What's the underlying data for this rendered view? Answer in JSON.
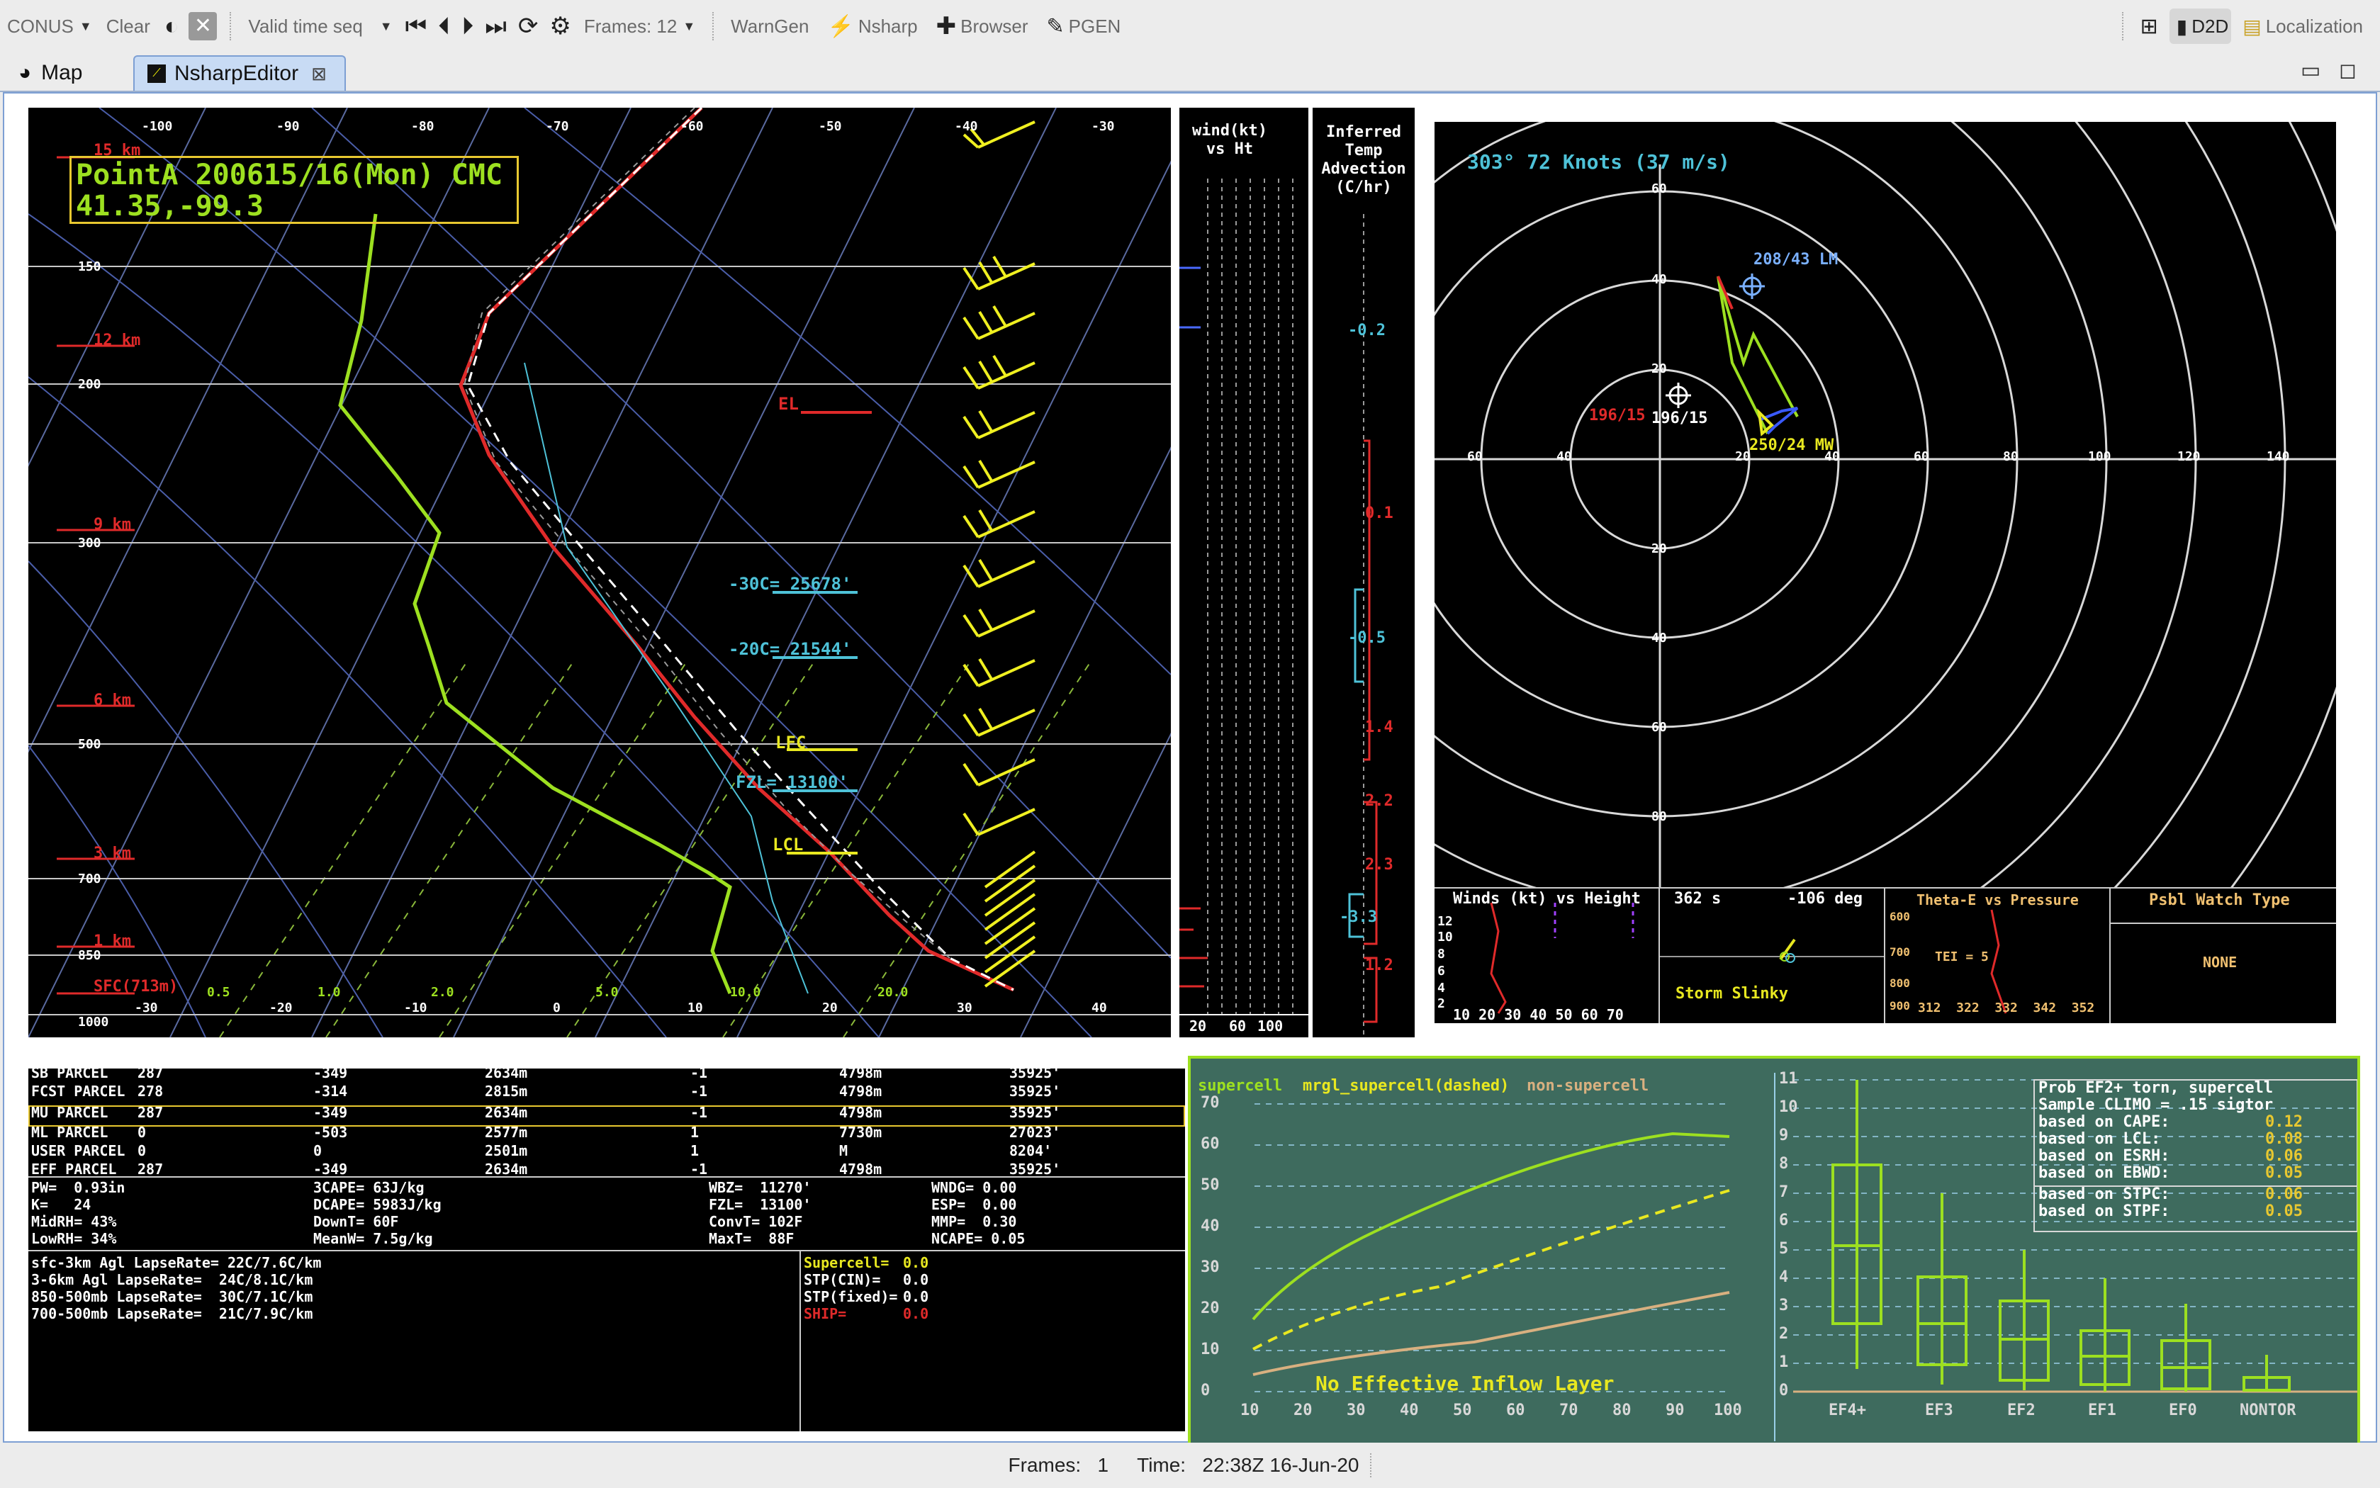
{
  "toolbar": {
    "scale": "CONUS",
    "clear": "Clear",
    "time_mode": "Valid time seq",
    "frames": "Frames: 12",
    "warngen": "WarnGen",
    "nsharp": "Nsharp",
    "browser": "Browser",
    "pgen": "PGEN",
    "d2d": "D2D",
    "localization": "Localization"
  },
  "tabs": [
    {
      "label": "Map"
    },
    {
      "label": "NsharpEditor"
    }
  ],
  "skewt": {
    "title_line1": "PointA 200615/16(Mon) CMC",
    "title_line2": "41.35,-99.3",
    "top_ticks": [
      "-100",
      "-90",
      "-80",
      "-70",
      "-60",
      "-50",
      "-40",
      "-30"
    ],
    "bottom_ticks": [
      "-30",
      "-20",
      "-10",
      "0",
      "10",
      "20",
      "30",
      "40"
    ],
    "pressure_labels": [
      "150",
      "200",
      "300",
      "500",
      "700",
      "850",
      "1000"
    ],
    "height_labels": [
      "15 km",
      "12 km",
      "9 km",
      "6 km",
      "3 km",
      "1 km",
      "SFC(713m)"
    ],
    "mixing_labels": [
      "0.5",
      "1.0",
      "2.0",
      "5.0",
      "10.0",
      "20.0"
    ],
    "levels": {
      "el": "EL",
      "m30": "-30C= 25678'",
      "m20": "-20C= 21544'",
      "lfc": "LFC",
      "fzl": "FZL= 13100'",
      "lcl": "LCL"
    }
  },
  "wind_panel": {
    "title": "wind(kt)\nvs Ht",
    "ticks": [
      "20",
      "60",
      "100"
    ]
  },
  "advection": {
    "title": "Inferred\nTemp\nAdvection\n(C/hr)",
    "values": [
      "-0.2",
      "0.1",
      "-0.5",
      "1.4",
      "2.2",
      "2.3",
      "-3.3",
      "1.2"
    ]
  },
  "hodograph": {
    "header": "303°  72 Knots (37 m/s)",
    "rm": "196/15",
    "rm2": "196/15",
    "lm": "208/43 LM",
    "mw": "250/24 MW",
    "ring_labels": [
      "60",
      "40",
      "20",
      "20",
      "40",
      "60",
      "80",
      "100",
      "120",
      "140"
    ],
    "ring_labels_v": [
      "60",
      "40",
      "20",
      "20",
      "40",
      "60",
      "80"
    ]
  },
  "insets": {
    "winds_title": "Winds (kt) vs Height",
    "winds_ticks": "10 20 30 40 50 60 70",
    "winds_y": [
      "12",
      "10",
      "8",
      "6",
      "4",
      "2"
    ],
    "slinky_speed": "362 s",
    "slinky_dir": "-106 deg",
    "slinky_label": "Storm Slinky",
    "theta_title": "Theta-E vs Pressure",
    "theta_tei": "TEI = 5",
    "theta_p": [
      "600",
      "700",
      "800",
      "900"
    ],
    "theta_x": "312  322  332  342  352",
    "watch_title": "Psbl Watch Type",
    "watch_value": "NONE"
  },
  "parcels": [
    {
      "name": "SB PARCEL",
      "v1": "287",
      "v2": "-349",
      "v3": "2634m",
      "v4": "-1",
      "v5": "4798m",
      "v6": "35925'"
    },
    {
      "name": "FCST PARCEL",
      "v1": "278",
      "v2": "-314",
      "v3": "2815m",
      "v4": "-1",
      "v5": "4798m",
      "v6": "35925'"
    },
    {
      "name": "MU PARCEL",
      "v1": "287",
      "v2": "-349",
      "v3": "2634m",
      "v4": "-1",
      "v5": "4798m",
      "v6": "35925'"
    },
    {
      "name": "ML PARCEL",
      "v1": "0",
      "v2": "-503",
      "v3": "2577m",
      "v4": "1",
      "v5": "7730m",
      "v6": "27023'"
    },
    {
      "name": "USER PARCEL",
      "v1": "0",
      "v2": "0",
      "v3": "2501m",
      "v4": "1",
      "v5": "M",
      "v6": "8204'"
    },
    {
      "name": "EFF PARCEL",
      "v1": "287",
      "v2": "-349",
      "v3": "2634m",
      "v4": "-1",
      "v5": "4798m",
      "v6": "35925'"
    }
  ],
  "indices": {
    "col1": [
      "PW=  0.93in",
      "K=   24",
      "MidRH= 43%",
      "LowRH= 34%"
    ],
    "col2": [
      "3CAPE= 63J/kg",
      "DCAPE= 5983J/kg",
      "DownT= 60F",
      "MeanW= 7.5g/kg"
    ],
    "col3": [
      "WBZ=  11270'",
      "FZL=  13100'",
      "ConvT= 102F",
      "MaxT=  88F"
    ],
    "col4": [
      "WNDG= 0.00",
      "ESP=  0.00",
      "MMP=  0.30",
      "NCAPE= 0.05"
    ]
  },
  "lapse": [
    "sfc-3km Agl LapseRate= 22C/7.6C/km",
    "3-6km Agl LapseRate=  24C/8.1C/km",
    "850-500mb LapseRate=  30C/7.1C/km",
    "700-500mb LapseRate=  21C/7.9C/km"
  ],
  "params": {
    "supercell": "Supercell=",
    "supercell_v": "0.0",
    "stp_cin": "STP(CIN)=",
    "stp_cin_v": "0.0",
    "stp_fixed": "STP(fixed)=",
    "stp_fixed_v": "0.0",
    "ship": "SHIP=",
    "ship_v": "0.0"
  },
  "stp_chart": {
    "legend_a": "supercell",
    "legend_b": "mrgl_supercell(dashed)",
    "legend_c": "non-supercell",
    "note": "No Effective Inflow Layer",
    "x_ticks": [
      "10",
      "20",
      "30",
      "40",
      "50",
      "60",
      "70",
      "80",
      "90",
      "100"
    ],
    "y_ticks": [
      "70",
      "60",
      "50",
      "40",
      "30",
      "20",
      "10",
      "0"
    ]
  },
  "prob_box": {
    "title1": "Prob EF2+ torn, supercell",
    "title2": "Sample CLIMO = .15 sigtor",
    "rows": [
      {
        "label": "based on CAPE:",
        "value": "0.12"
      },
      {
        "label": "based on LCL:",
        "value": "0.08"
      },
      {
        "label": "based on ESRH:",
        "value": "0.06"
      },
      {
        "label": "based on EBWD:",
        "value": "0.05"
      },
      {
        "label": "based on STPC:",
        "value": "0.06"
      },
      {
        "label": "based on STPF:",
        "value": "0.05"
      }
    ],
    "categories": [
      "EF4+",
      "EF3",
      "EF2",
      "EF1",
      "EF0",
      "NONTOR"
    ],
    "y_ticks": [
      "11",
      "10",
      "9",
      "8",
      "7",
      "6",
      "5",
      "4",
      "3",
      "2",
      "1",
      "0"
    ]
  },
  "status": {
    "frames": "Frames:   1",
    "time": "Time:   22:38Z 16-Jun-20"
  }
}
